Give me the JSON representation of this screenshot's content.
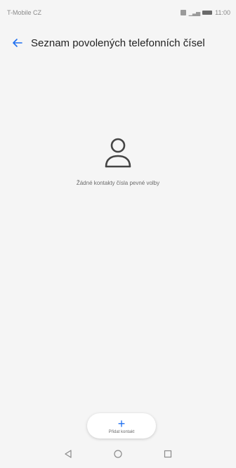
{
  "status_bar": {
    "carrier": "T-Mobile CZ",
    "time": "11:00",
    "sim_icon": "sim-icon",
    "signal_icon": "signal-icon",
    "battery_icon": "battery-icon"
  },
  "header": {
    "back_icon": "back-arrow-icon",
    "title": "Seznam povolených telefonních čísel"
  },
  "empty_state": {
    "icon": "person-icon",
    "message": "Žádné kontakty čísla pevné volby"
  },
  "fab": {
    "icon": "plus-icon",
    "label": "Přidat kontakt"
  },
  "nav_bar": {
    "back": "nav-back-icon",
    "home": "nav-home-icon",
    "recents": "nav-recents-icon"
  },
  "colors": {
    "accent": "#1e6ff0",
    "background": "#f5f5f5"
  }
}
